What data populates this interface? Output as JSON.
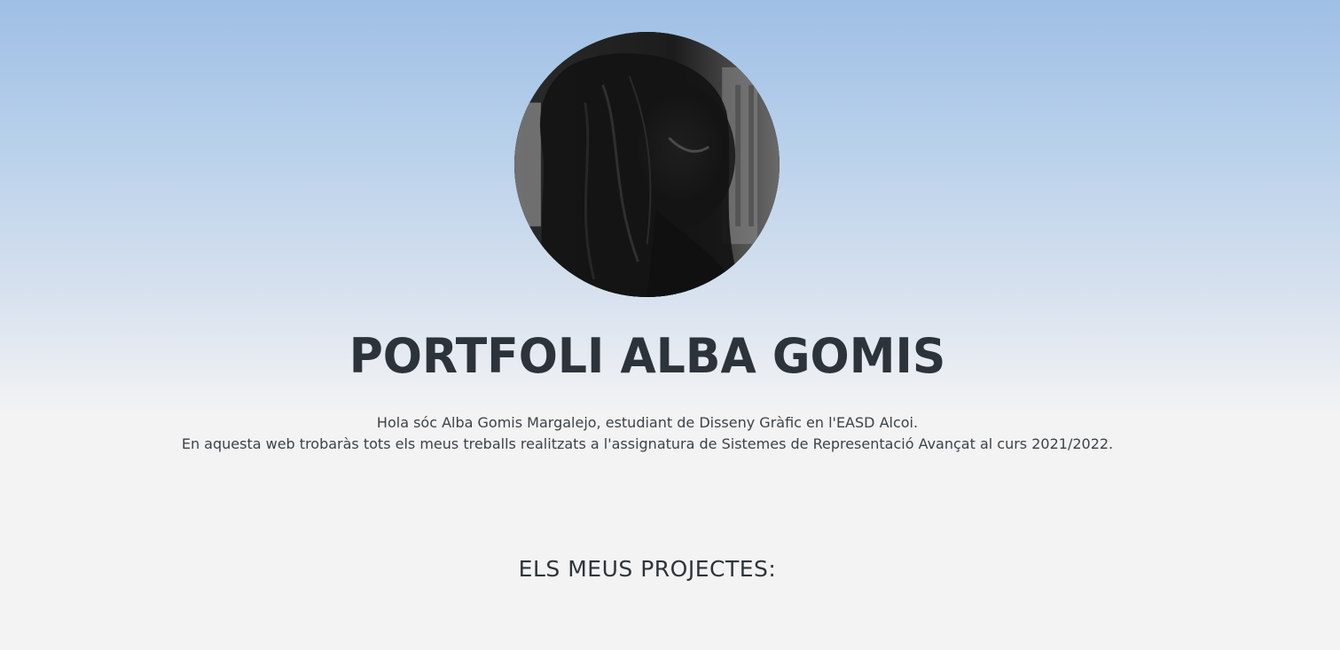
{
  "profile": {
    "photo_icon": "portrait-photo"
  },
  "header": {
    "title": "PORTFOLI ALBA GOMIS"
  },
  "intro": {
    "line1": "Hola sóc Alba Gomis Margalejo, estudiant de Disseny Gràfic en l'EASD Alcoi.",
    "line2": "En aquesta web trobaràs tots els meus treballs realitzats a l'assignatura de Sistemes de Representació Avançat al curs 2021/2022."
  },
  "projects": {
    "heading": "ELS MEUS PROJECTES:"
  },
  "colors": {
    "background_top": "#9fbfe5",
    "background_bottom": "#f3f3f3",
    "text_dark": "#2c333b"
  }
}
